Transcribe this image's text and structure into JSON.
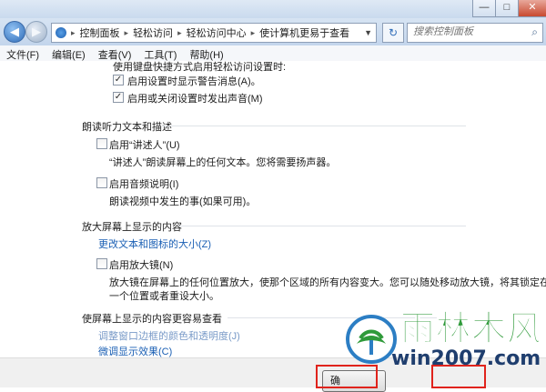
{
  "window": {
    "minimize": "—",
    "maximize": "□",
    "close": "✕"
  },
  "address": {
    "crumbs": [
      "控制面板",
      "轻松访问",
      "轻松访问中心",
      "使计算机更易于查看"
    ],
    "search_placeholder": "搜索控制面板"
  },
  "menu": [
    "文件(F)",
    "编辑(E)",
    "查看(V)",
    "工具(T)",
    "帮助(H)"
  ],
  "content": {
    "keyboard_note": "使用键盘快捷方式启用轻松访问设置时:",
    "opt_warning": {
      "label": "启用设置时显示警告消息(A)。",
      "checked": true
    },
    "opt_sound": {
      "label": "启用或关闭设置时发出声音(M)",
      "checked": true
    },
    "narrator_section": "朗读听力文本和描述",
    "narrator": {
      "label": "启用“讲述人”(U)",
      "desc": "“讲述人”朗读屏幕上的任何文本。您将需要扬声器。",
      "checked": false
    },
    "audio_desc": {
      "label": "启用音频说明(I)",
      "desc": "朗读视频中发生的事(如果可用)。",
      "checked": false
    },
    "magnify_section": "放大屏幕上显示的内容",
    "change_size_link": "更改文本和图标的大小(Z)",
    "magnifier": {
      "label": "启用放大镜(N)",
      "desc_line1": "放大镜在屏幕上的任何位置放大，使那个区域的所有内容变大。您可以随处移动放大镜，将其锁定在",
      "desc_line2": "一个位置或者重设大小。",
      "checked": false
    },
    "easier_section": "使屏幕上显示的内容更容易查看",
    "adjust_border_link": "调整窗口边框的颜色和透明度(J)",
    "fine_tune_link": "微调显示效果(C)"
  },
  "footer": {
    "ok": "确"
  },
  "watermark": {
    "brand": "雨林木风",
    "site": "win2007.com"
  },
  "colors": {
    "link": "#1a5fb4",
    "highlight_box": "#e0231c",
    "logo_green": "#2f9a3a"
  }
}
